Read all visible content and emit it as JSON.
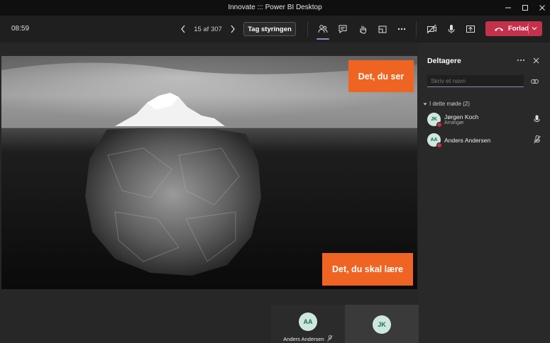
{
  "window": {
    "title": "Innovate ::: Power BI Desktop"
  },
  "toolbar": {
    "timer": "08:59",
    "page_counter": "15 af 307",
    "take_control_label": "Tag styringen",
    "leave_label": "Forlad"
  },
  "slide": {
    "callout_top": "Det, du ser",
    "callout_bottom": "Det, du skal lære"
  },
  "tiles": [
    {
      "initials": "AA",
      "name": "Anders Andersen"
    },
    {
      "initials": "JK"
    }
  ],
  "panel": {
    "title": "Deltagere",
    "search_placeholder": "Skriv et navn",
    "section_label": "I dette møde (2)",
    "participants": [
      {
        "initials": "JK",
        "name": "Jørgen Koch",
        "role": "Arrangør"
      },
      {
        "initials": "AA",
        "name": "Anders Andersen"
      }
    ]
  },
  "colors": {
    "accent": "#8b8cc7",
    "leave": "#c4314b",
    "callout": "#f06423"
  }
}
